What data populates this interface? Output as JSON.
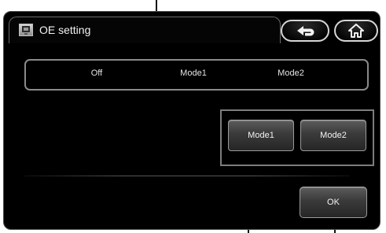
{
  "header": {
    "title": "OE setting",
    "title_icon": "monitor-icon",
    "back_icon": "return-arrow-icon",
    "home_icon": "home-icon"
  },
  "mode_bar": {
    "options": [
      "Off",
      "Mode1",
      "Mode2"
    ]
  },
  "mode_buttons": {
    "mode1_label": "Mode1",
    "mode2_label": "Mode2"
  },
  "ok_button": {
    "label": "OK"
  }
}
